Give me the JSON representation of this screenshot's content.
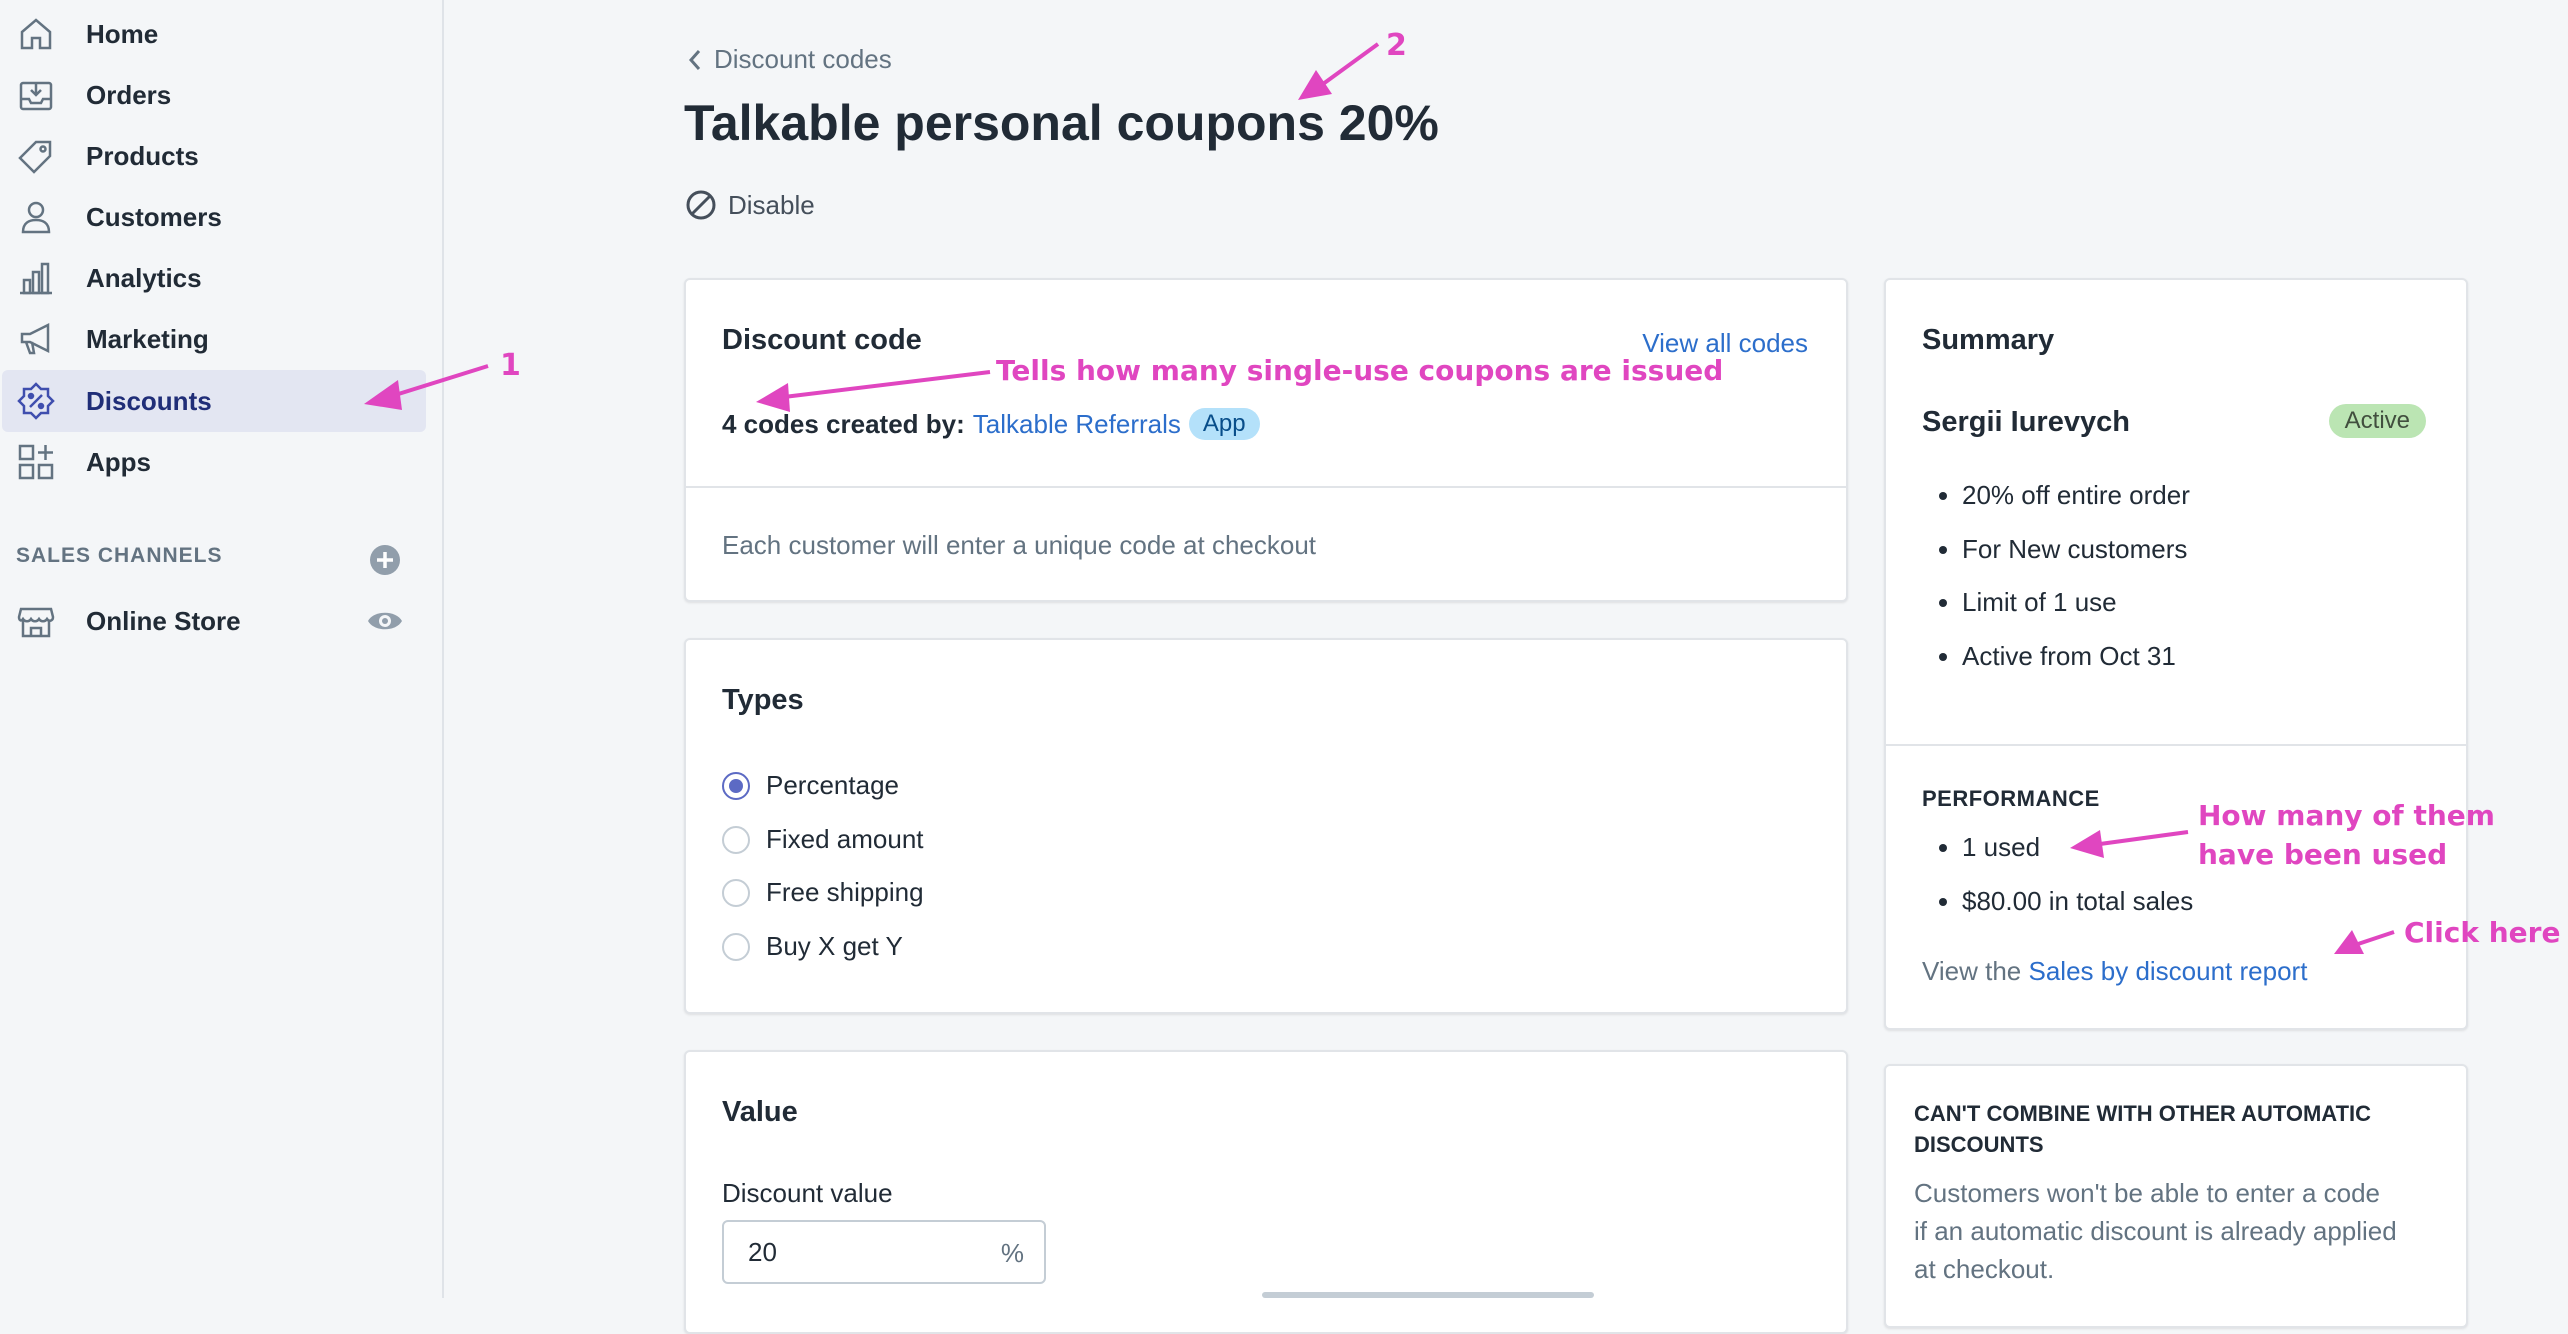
{
  "sidebar": {
    "items": [
      {
        "label": "Home",
        "icon": "home-icon"
      },
      {
        "label": "Orders",
        "icon": "orders-icon"
      },
      {
        "label": "Products",
        "icon": "tag-icon"
      },
      {
        "label": "Customers",
        "icon": "person-icon"
      },
      {
        "label": "Analytics",
        "icon": "bar-chart-icon"
      },
      {
        "label": "Marketing",
        "icon": "megaphone-icon"
      },
      {
        "label": "Discounts",
        "icon": "discount-icon",
        "active": true
      },
      {
        "label": "Apps",
        "icon": "apps-icon"
      }
    ],
    "sales_channels_heading": "SALES CHANNELS",
    "channels": [
      {
        "label": "Online Store",
        "icon": "store-icon"
      }
    ]
  },
  "header": {
    "breadcrumb": "Discount codes",
    "title": "Talkable personal coupons 20%",
    "disable_label": "Disable"
  },
  "discount_code_card": {
    "title": "Discount code",
    "view_all_link": "View all codes",
    "codes_created_prefix": "4 codes created by:",
    "creator_link": "Talkable Referrals",
    "creator_badge": "App",
    "note": "Each customer will enter a unique code at checkout"
  },
  "types_card": {
    "title": "Types",
    "options": [
      "Percentage",
      "Fixed amount",
      "Free shipping",
      "Buy X get Y"
    ],
    "selected": "Percentage"
  },
  "value_card": {
    "title": "Value",
    "field_label": "Discount value",
    "field_value": "20",
    "field_suffix": "%"
  },
  "summary_card": {
    "title": "Summary",
    "name": "Sergii Iurevych",
    "status": "Active",
    "details": [
      "20% off entire order",
      "For New customers",
      "Limit of 1 use",
      "Active from Oct 31"
    ],
    "performance_heading": "PERFORMANCE",
    "performance": [
      "1 used",
      "$80.00 in total sales"
    ],
    "report_prefix": "View the",
    "report_link": "Sales by discount report"
  },
  "combine_card": {
    "heading_line1": "CAN'T COMBINE WITH OTHER AUTOMATIC",
    "heading_line2": "DISCOUNTS",
    "text_line1": "Customers won't be able to enter a code",
    "text_line2": "if an automatic discount is already applied",
    "text_line3": "at checkout."
  },
  "annotations": {
    "one": "1",
    "two": "2",
    "codes_note": "Tells how many single-use coupons are issued",
    "used_note_line1": "How many of them",
    "used_note_line2": "have been used",
    "click_here": "Click here"
  },
  "colors": {
    "annotation": "#e046c0",
    "link": "#2c6ecb",
    "active_nav_bg": "#e3e6f2",
    "active_badge_bg": "#bbe5b3",
    "app_badge_bg": "#b4e1fa"
  }
}
